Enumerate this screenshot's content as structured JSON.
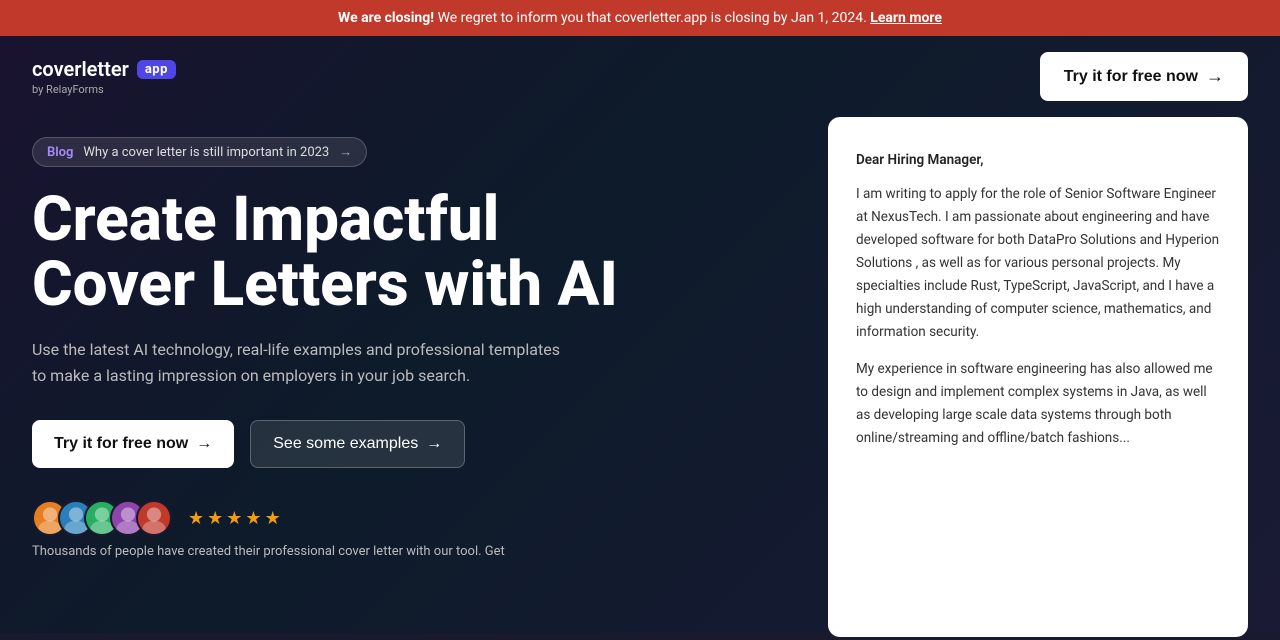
{
  "banner": {
    "prefix": "We are closing!",
    "text": " We regret to inform you that coverletter.app is closing by Jan 1, 2024.",
    "link_text": "Learn more",
    "link_href": "#"
  },
  "header": {
    "logo_cover": "coverletter",
    "logo_app": "app",
    "logo_by": "by RelayForms",
    "cta_label": "Try it for free now",
    "cta_arrow": "→"
  },
  "blog_tag": {
    "label": "Blog",
    "title": "Why a cover letter is still important in 2023",
    "arrow": "→"
  },
  "hero": {
    "line1": "Create Impactful",
    "line2": "Cover Letters with AI"
  },
  "sub": "Use the latest AI technology, real-life examples and professional templates to make a lasting impression on employers in your job search.",
  "buttons": {
    "primary_label": "Try it for free now",
    "primary_arrow": "→",
    "secondary_label": "See some examples",
    "secondary_arrow": "→"
  },
  "avatars": [
    {
      "initial": "",
      "color_class": "avatar-1"
    },
    {
      "initial": "",
      "color_class": "avatar-2"
    },
    {
      "initial": "",
      "color_class": "avatar-3"
    },
    {
      "initial": "",
      "color_class": "avatar-4"
    },
    {
      "initial": "",
      "color_class": "avatar-5"
    }
  ],
  "stars": [
    "★",
    "★",
    "★",
    "★",
    "★"
  ],
  "social_proof_text": "Thousands of people have created their professional cover letter with our tool. Get",
  "letter": {
    "greeting": "Dear Hiring Manager,",
    "paragraphs": [
      "I am writing to apply for the role of Senior Software Engineer at NexusTech. I am passionate about engineering and have developed software for both DataPro Solutions and Hyperion Solutions , as well as for various personal projects. My specialties include Rust, TypeScript,  JavaScript, and I have a high understanding of computer science, mathematics, and information security.",
      "My experience in software engineering has also allowed me to design and implement complex systems in Java, as well as developing large scale data systems through both online/streaming and offline/batch fashions..."
    ]
  }
}
